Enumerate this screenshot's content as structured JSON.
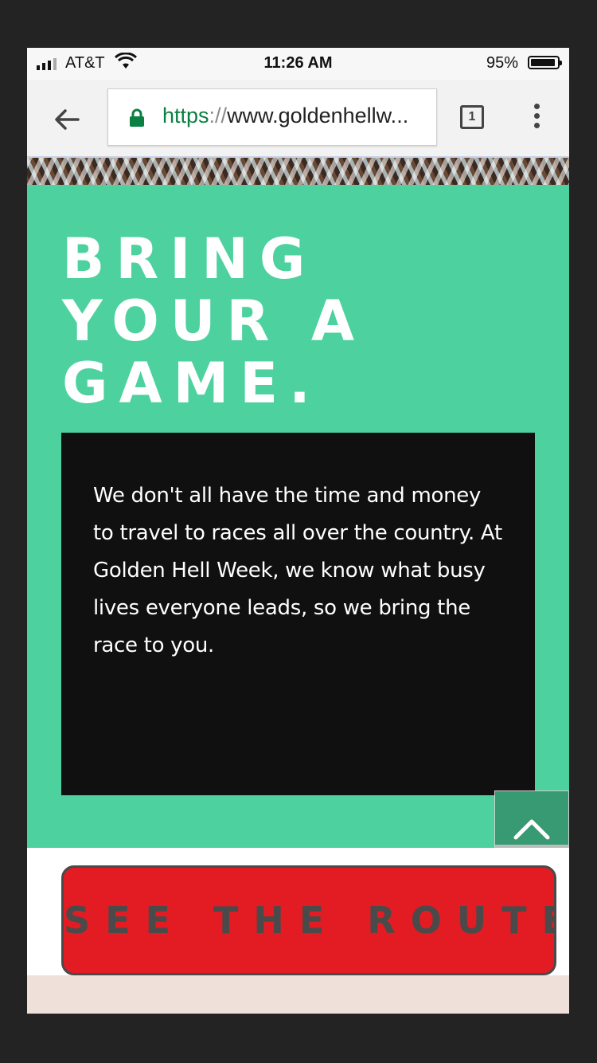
{
  "status_bar": {
    "carrier": "AT&T",
    "time": "11:26 AM",
    "battery_percent": "95%",
    "battery_level": 0.95,
    "signal_icon": "cellular-signal-icon",
    "wifi_icon": "wifi-icon",
    "battery_icon": "battery-icon"
  },
  "browser": {
    "url_scheme": "https",
    "url_separator": "://",
    "url_rest": "www.goldenhellw...",
    "tab_count": "1",
    "back_icon": "back-arrow-icon",
    "lock_icon": "lock-icon",
    "menu_icon": "kebab-menu-icon",
    "lock_color": "#0b8043"
  },
  "hero": {
    "headline_lines": [
      "BRING",
      "YOUR A",
      "GAME."
    ],
    "body": "We don't all have the time and money to travel to races all over the country. At Golden Hell Week, we know what busy lives everyone leads, so we bring the race to you."
  },
  "back_to_top": {
    "icon": "chevron-up-icon"
  },
  "cta": {
    "label": "SEE THE ROUTES"
  },
  "colors": {
    "accent_green": "#4dd29f",
    "card_black": "#101010",
    "cta_red": "#e31b23",
    "cta_text": "#4a4a4a",
    "back_to_top_green": "#379a73",
    "footer_beige": "#efe1d9"
  }
}
